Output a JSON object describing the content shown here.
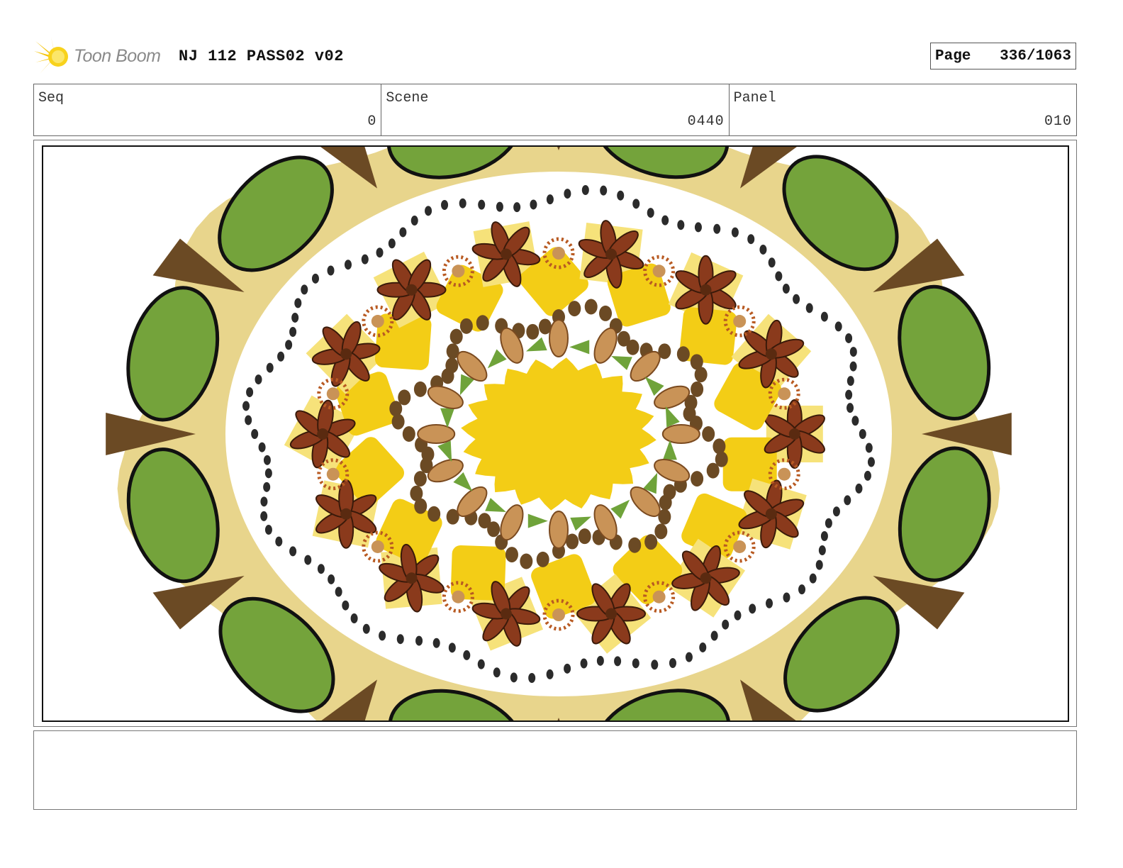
{
  "header": {
    "logo_text": "Toon Boom",
    "project_title": "NJ 112 PASS02 v02",
    "page_label": "Page",
    "page_value": "336/1063"
  },
  "info": {
    "seq_label": "Seq",
    "seq_value": "0",
    "scene_label": "Scene",
    "scene_value": "0440",
    "panel_label": "Panel",
    "panel_value": "010"
  },
  "panel": {
    "image_description_icon": "mandala-spice-illustration",
    "colors": {
      "cream": "#e8d58c",
      "leaf_green": "#74a33b",
      "yellow": "#f3cd16",
      "light_yellow": "#f6e27a",
      "anise_brown": "#8a3a1c",
      "seed_tan": "#c99357",
      "dot_dark": "#2b2b2b",
      "coffee": "#6b4a24",
      "clove_orange": "#b85a22",
      "teal_green": "#6fa33a"
    }
  },
  "notes": {
    "text": ""
  }
}
